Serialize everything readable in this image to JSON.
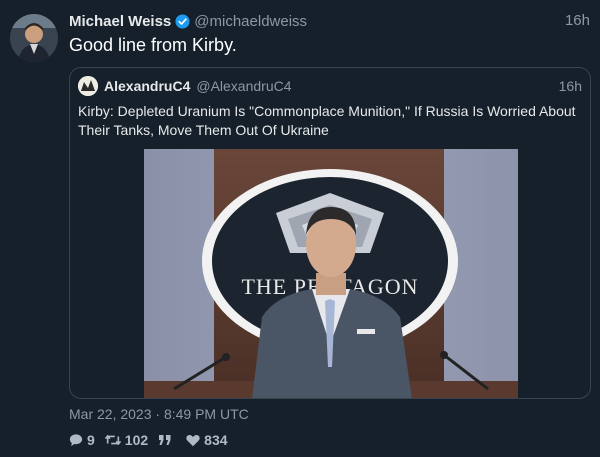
{
  "tweet": {
    "author_name": "Michael Weiss",
    "author_handle": "@michaeldweiss",
    "time": "16h",
    "text": "Good line from Kirby.",
    "timestamp": "Mar 22, 2023 · 8:49 PM UTC"
  },
  "quote": {
    "author_name": "AlexandruC4",
    "author_handle": "@AlexandruC4",
    "time": "16h",
    "text": "Kirby: Depleted Uranium Is \"Commonplace Munition,\" If Russia Is Worried About Their Tanks, Move Them Out Of Ukraine",
    "media_sign_text": "THE PENTAGON"
  },
  "stats": {
    "replies": "9",
    "retweets": "102",
    "quotes": "",
    "likes": "834"
  },
  "icons": {
    "verified": "verified-badge-icon",
    "reply": "comment-icon",
    "retweet": "retweet-icon",
    "quote": "quote-icon",
    "like": "heart-icon"
  },
  "colors": {
    "background": "#15202b",
    "border": "#38444d",
    "verified": "#1d9bf0",
    "muted": "#8b98a5"
  }
}
